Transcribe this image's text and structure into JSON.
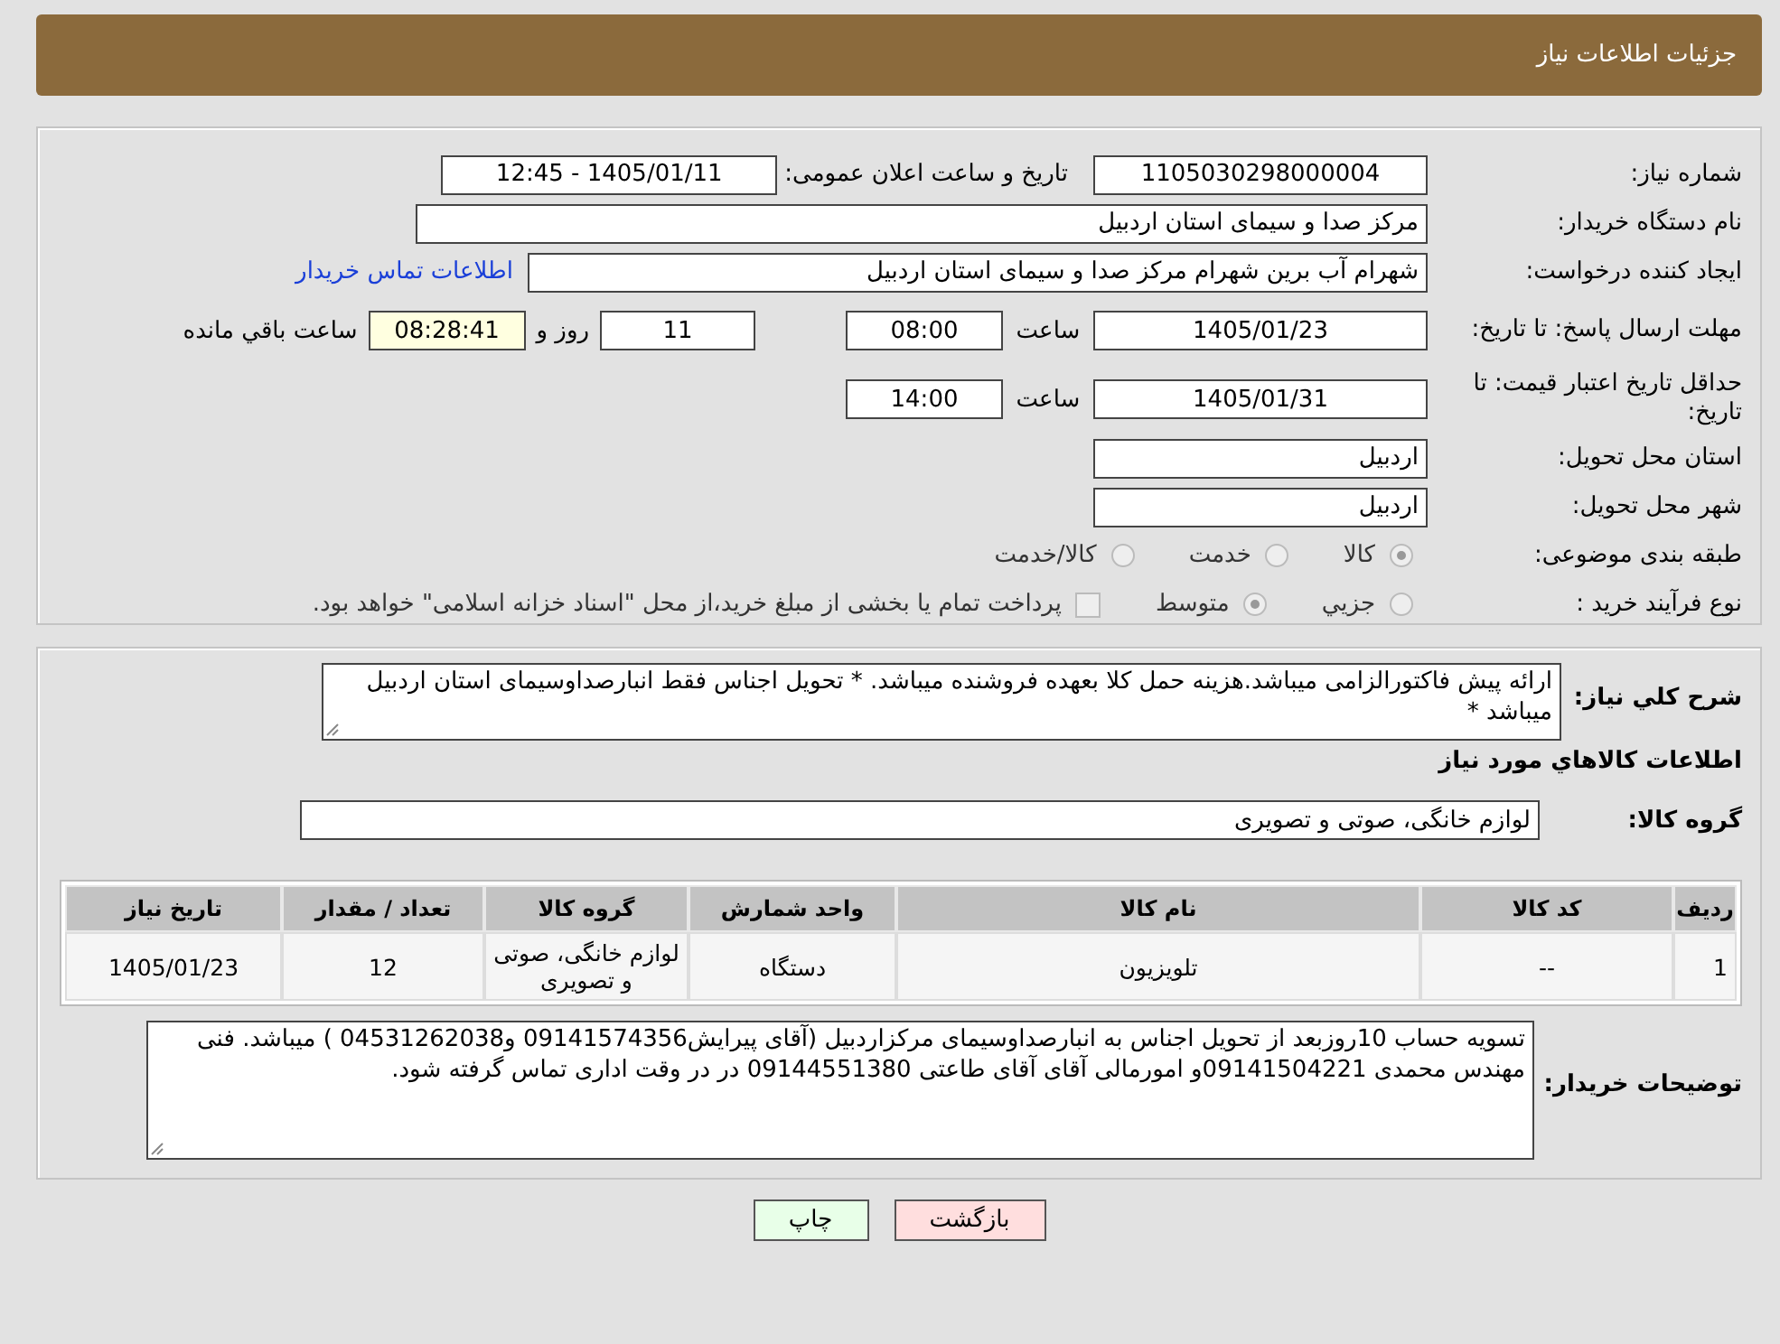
{
  "header": {
    "title": "جزئیات اطلاعات نیاز"
  },
  "details": {
    "need_number": {
      "label": "شماره نیاز:",
      "value": "1105030298000004"
    },
    "announce": {
      "label": "تاریخ و ساعت اعلان عمومی:",
      "value": "1405/01/11 - 12:45"
    },
    "buyer_org": {
      "label": "نام دستگاه خریدار:",
      "value": "مرکز صدا و سیمای استان اردبیل"
    },
    "requester": {
      "label": "ایجاد کننده درخواست:",
      "value": "شهرام آب برین شهرام مرکز صدا و سیمای استان اردبیل",
      "link": "اطلاعات تماس خریدار"
    },
    "reply_deadline": {
      "label": "مهلت ارسال پاسخ: تا تاریخ:",
      "date": "1405/01/23",
      "time_label": "ساعت",
      "time": "08:00",
      "days": "11",
      "days_label": "روز و",
      "remaining": "08:28:41",
      "remaining_label": "ساعت باقي مانده"
    },
    "price_validity": {
      "label": "حداقل تاریخ اعتبار قیمت: تا تاریخ:",
      "date": "1405/01/31",
      "time_label": "ساعت",
      "time": "14:00"
    },
    "province": {
      "label": "استان محل تحویل:",
      "value": "اردبیل"
    },
    "city": {
      "label": "شهر محل تحویل:",
      "value": "اردبیل"
    },
    "category": {
      "label": "طبقه بندی موضوعی:",
      "options": [
        {
          "label": "کالا",
          "selected": true
        },
        {
          "label": "خدمت",
          "selected": false
        },
        {
          "label": "کالا/خدمت",
          "selected": false
        }
      ]
    },
    "process": {
      "label": "نوع فرآیند خرید :",
      "options": [
        {
          "label": "جزيي",
          "selected": false
        },
        {
          "label": "متوسط",
          "selected": true
        }
      ],
      "payment": {
        "label": "پرداخت تمام یا بخشی از مبلغ خرید،از محل \"اسناد خزانه اسلامی\" خواهد بود.",
        "checked": false
      }
    }
  },
  "needs": {
    "description": {
      "label": "شرح کلي نیاز:",
      "value": "ارائه پیش فاکتورالزامی میباشد.هزینه حمل کلا بعهده فروشنده میباشد. * تحویل اجناس فقط انبارصداوسیمای استان اردبیل میباشد *"
    },
    "section_title": "اطلاعات کالاهاي مورد نياز",
    "goods_group": {
      "label": "گروه کالا:",
      "value": "لوازم خانگی، صوتی و تصویری"
    },
    "table": {
      "columns": [
        "ردیف",
        "کد کالا",
        "نام کالا",
        "واحد شمارش",
        "گروه کالا",
        "تعداد / مقدار",
        "تاریخ نیاز"
      ],
      "rows": [
        [
          "1",
          "--",
          "تلویزیون",
          "دستگاه",
          "لوازم خانگی، صوتی و تصویری",
          "12",
          "1405/01/23"
        ]
      ]
    },
    "buyer_notes": {
      "label": "توضیحات خریدار:",
      "value": "تسویه حساب 10روزبعد از تحویل اجناس به انبارصداوسیمای مرکزاردبیل (آقای پیرایش09141574356 و04531262038 ) میباشد. فنی مهندس محمدی 09141504221و امورمالی آقای آقای طاعتی 09144551380 در در وقت اداری تماس گرفته شود."
    }
  },
  "buttons": [
    {
      "kind": "back",
      "label": "بازگشت"
    },
    {
      "kind": "print",
      "label": "چاپ"
    }
  ]
}
